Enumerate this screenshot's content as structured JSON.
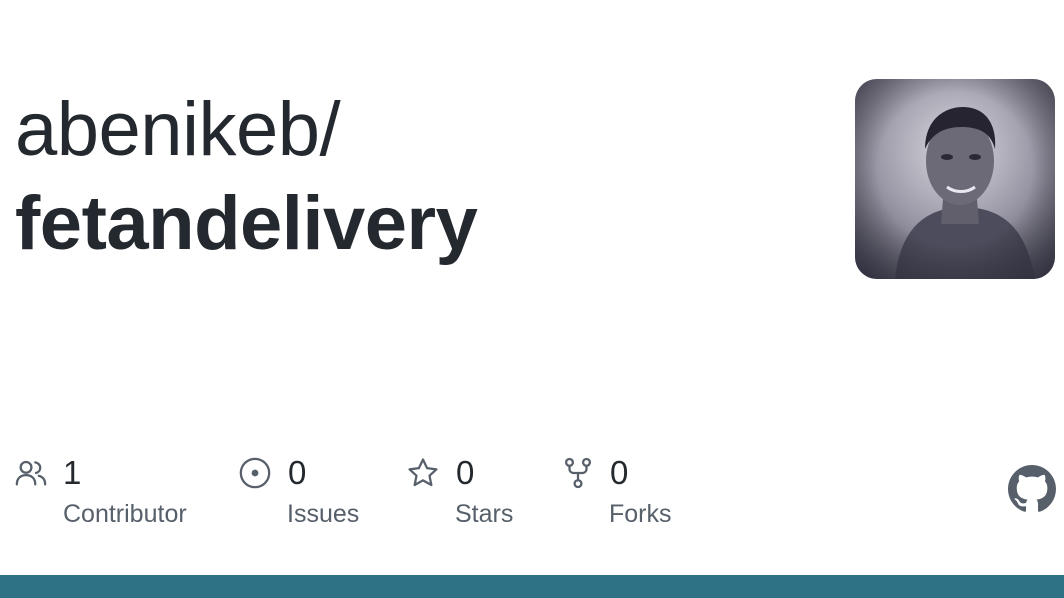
{
  "repo": {
    "owner": "abenikeb/",
    "name": "fetandelivery"
  },
  "avatar": {
    "alt": "abenikeb avatar"
  },
  "stats": [
    {
      "icon": "people-icon",
      "count": "1",
      "label": "Contributor"
    },
    {
      "icon": "issue-icon",
      "count": "0",
      "label": "Issues"
    },
    {
      "icon": "star-icon",
      "count": "0",
      "label": "Stars"
    },
    {
      "icon": "fork-icon",
      "count": "0",
      "label": "Forks"
    }
  ],
  "brand": {
    "icon": "github-mark-icon"
  },
  "colors": {
    "text": "#24292f",
    "muted": "#57606a",
    "bottom_bar": "#2e7286",
    "background": "#ffffff"
  }
}
